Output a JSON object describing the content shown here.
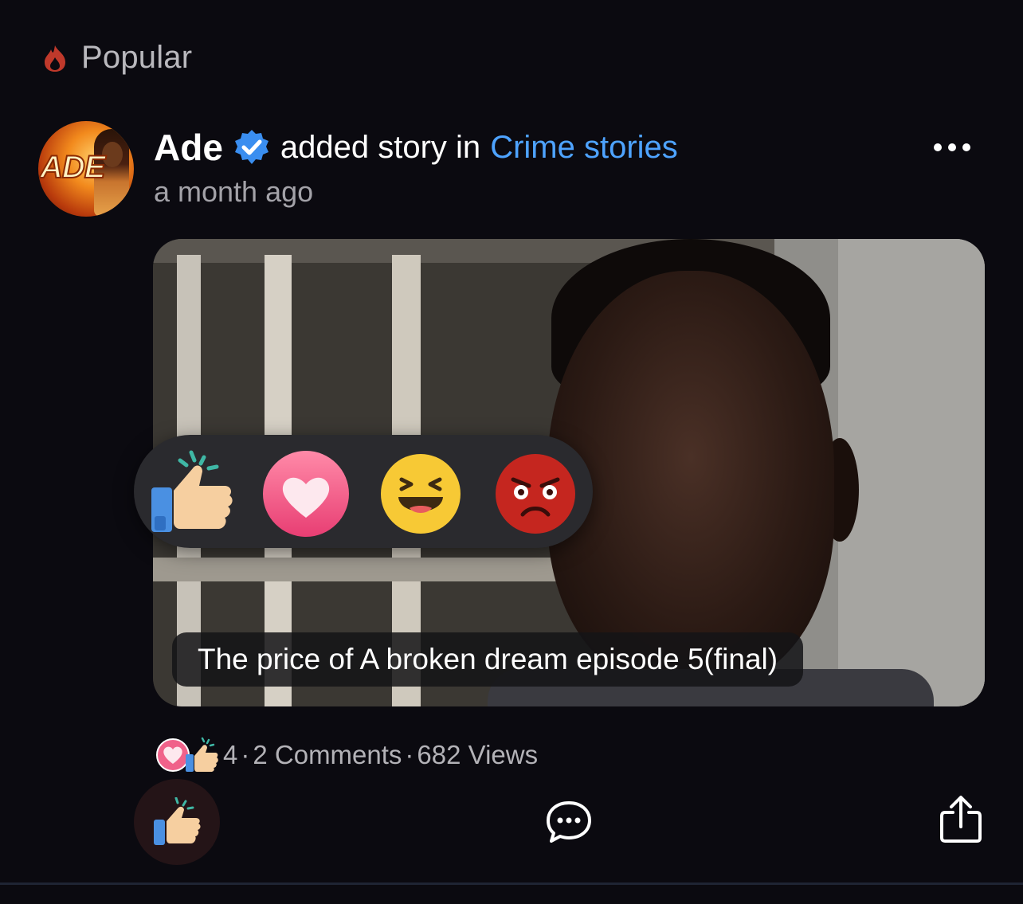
{
  "section": {
    "title": "Popular",
    "icon": "flame-icon"
  },
  "post": {
    "author": "Ade",
    "author_verified": true,
    "avatar_text": "ADE",
    "action_text": "added story in",
    "community": "Crime stories",
    "timestamp": "a month ago",
    "menu_icon": "more-horizontal-icon",
    "story_title": "The price of A broken dream episode 5(final)"
  },
  "reactions": [
    {
      "name": "like",
      "icon": "thumbs-up-icon"
    },
    {
      "name": "love",
      "icon": "heart-icon"
    },
    {
      "name": "haha",
      "icon": "laughing-face-icon"
    },
    {
      "name": "angry",
      "icon": "angry-face-icon"
    }
  ],
  "stats": {
    "reaction_count": "4",
    "separator": "·",
    "comments": "2 Comments",
    "views": "682 Views"
  },
  "actions": {
    "like_icon": "thumbs-up-icon",
    "comment_icon": "comment-bubble-icon",
    "share_icon": "share-icon"
  },
  "colors": {
    "background": "#0b0a10",
    "link": "#4ea3ff",
    "verified": "#3a8ef0",
    "muted_text": "#a3a2a8"
  }
}
